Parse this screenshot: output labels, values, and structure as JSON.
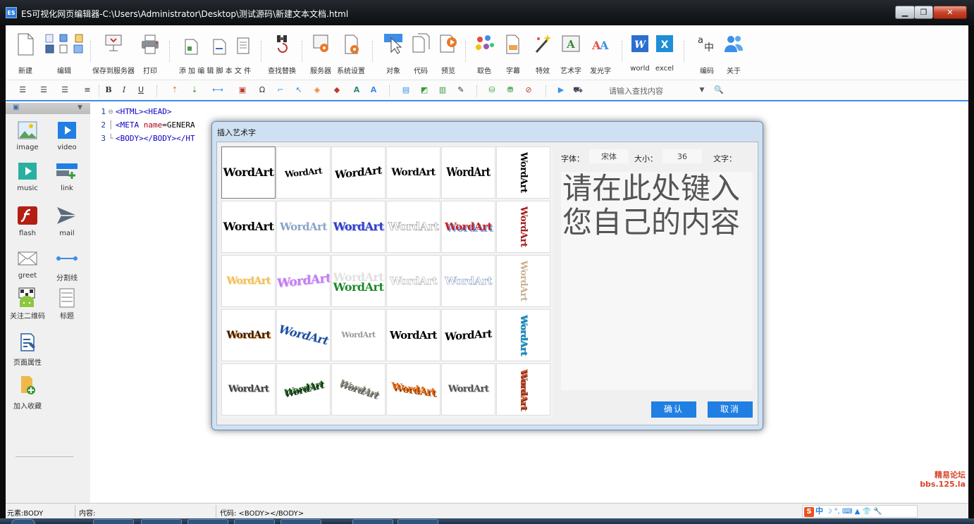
{
  "window": {
    "app_icon": "ES",
    "title": "ES可视化网页编辑器-C:\\Users\\Administrator\\Desktop\\测试源码\\新建文本文档.html"
  },
  "toolbar1": {
    "new": "新建",
    "edit": "编辑",
    "save_to_server": "保存到服务器",
    "print": "打印",
    "add_edit_script": "添 加 编 辑 脚 本 文 件",
    "find_replace": "查找替换",
    "server": "服务器",
    "system_settings": "系统设置",
    "object": "对象",
    "code": "代码",
    "preview": "预览",
    "color_pick": "取色",
    "subtitle": "字幕",
    "effects": "特效",
    "art_text": "艺术字",
    "glow_text": "发光字",
    "world": "world",
    "excel": "excel",
    "encoding": "编码",
    "about": "关于"
  },
  "toolbar2": {
    "search_placeholder": "请输入查找内容"
  },
  "sidebar": {
    "items": [
      "image",
      "video",
      "music",
      "link",
      "flash",
      "mail",
      "greet",
      "分割线",
      "关注二维码",
      "标题",
      "页面属性",
      "加入收藏"
    ]
  },
  "editor": {
    "lines": [
      {
        "num": "1",
        "text": "<HTML><HEAD>"
      },
      {
        "num": "2",
        "tag": "<META ",
        "attr": "name",
        "rest": "=GENERA"
      },
      {
        "num": "3",
        "text": "<BODY></BODY></HT"
      }
    ]
  },
  "status": {
    "element": "元素:BODY",
    "content": "内容:",
    "code": "代码: <BODY></BODY>"
  },
  "ime": {
    "logo": "S",
    "mode": "中",
    "symbols": "☽ °, ⌨ ▲ 👕 🔧"
  },
  "watermark": {
    "line1": "精易论坛",
    "line2": "bbs.125.la"
  },
  "dialog": {
    "title": "插入艺术字",
    "font_label": "字体：",
    "font_value": "宋体",
    "size_label": "大小：",
    "size_value": "36",
    "text_label": "文字：",
    "text_value": "请在此处键入您自己的内容",
    "ok": "确认",
    "cancel": "取消",
    "wordart_text": "WordArt",
    "styles_count": 30
  },
  "colors": {
    "accent": "#3d8ee8",
    "dialog_button": "#1f7fe3",
    "code_tag": "#0c00c4",
    "code_attr": "#b2001e"
  }
}
